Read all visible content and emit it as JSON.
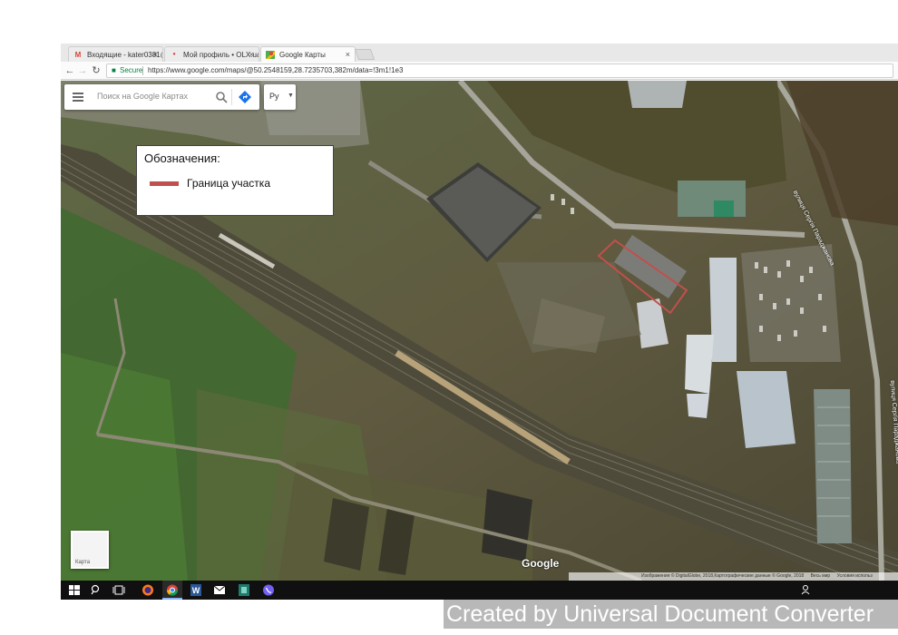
{
  "browser": {
    "tabs": [
      {
        "label": "Входящие - kater0381@",
        "icon": "gmail-icon"
      },
      {
        "label": "Мой профиль • OLX.ua",
        "icon": "olx-icon"
      },
      {
        "label": "Google Карты",
        "icon": "google-maps-icon",
        "active": true
      }
    ],
    "tab_close": "×",
    "secure_label": "Secure",
    "url": "https://www.google.com/maps/@50.2548159,28.7235703,382m/data=!3m1!1e3"
  },
  "map": {
    "search_placeholder": "Поиск на Google Картах",
    "language": "Ру",
    "layer_label": "Карта",
    "google_logo": "Google",
    "attribution": [
      "Изображения © DigitalGlobe, 2018,Картографические данные © Google, 2018",
      "Весь мир",
      "Условия использ"
    ],
    "street_labels": [
      "вулиця Сергія Параджанова",
      "вулиця Сергія Параджанова"
    ],
    "legend": {
      "title": "Обозначения:",
      "item_label": "Граница участка",
      "item_color": "#c0504d"
    },
    "parcel_color": "#c0504d"
  },
  "taskbar": {
    "items": [
      "windows-start-icon",
      "search-icon",
      "task-view-icon",
      "firefox-icon",
      "chrome-icon",
      "word-icon",
      "mail-icon",
      "app-icon",
      "viber-icon"
    ]
  },
  "watermark": "Created by Universal Document Converter"
}
